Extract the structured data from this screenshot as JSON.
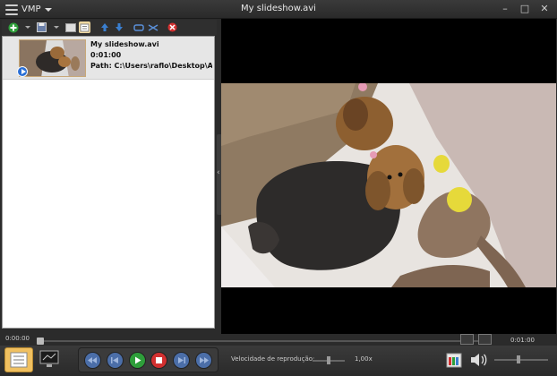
{
  "app": {
    "name": "VMP",
    "window_title": "My slideshow.avi"
  },
  "window_controls": {
    "minimize": "–",
    "maximize": "□",
    "close": "✕"
  },
  "playlist": {
    "items": [
      {
        "title": "My slideshow.avi",
        "duration": "0:01:00",
        "path": "Path: C:\\Users\\raflo\\Desktop\\Arq"
      }
    ]
  },
  "collapse_glyph": "‹",
  "player": {
    "elapsed": "0:00:00",
    "total": "0:01:00",
    "seek_progress": 0.0,
    "speed_label": "Velocidade de reprodução:",
    "speed_value": "1,00x"
  },
  "colors": {
    "accent_green": "#2e9e3a",
    "stop_red": "#d23030",
    "transport_blue": "#4b6ea8",
    "playlist_selected": "#e6e6e6"
  },
  "icons": [
    "add-icon",
    "save-icon",
    "open-icon",
    "playlist-view-icon",
    "move-up-icon",
    "move-down-icon",
    "repeat-icon",
    "shuffle-icon",
    "remove-icon",
    "skip-back-icon",
    "prev-icon",
    "play-icon",
    "stop-icon",
    "next-icon",
    "skip-forward-icon",
    "screenshot-icon",
    "volume-icon"
  ]
}
